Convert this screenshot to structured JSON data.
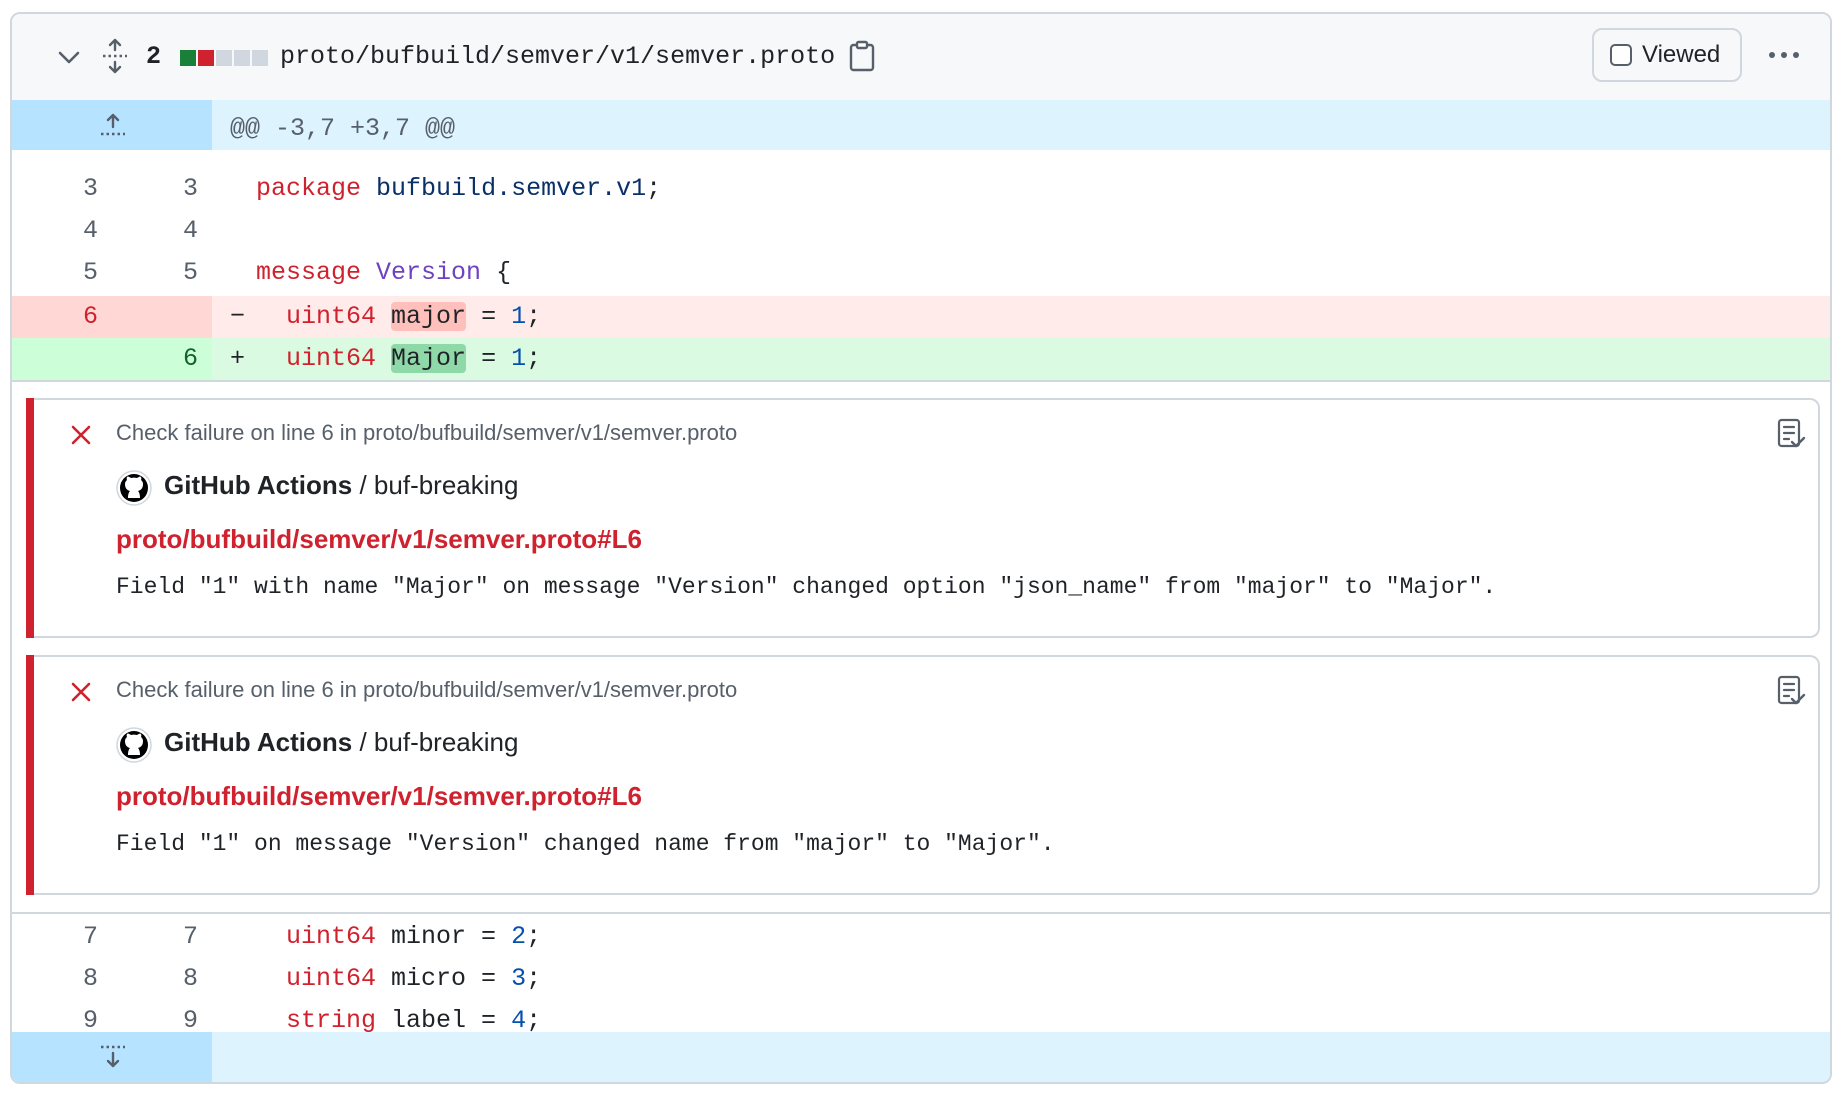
{
  "header": {
    "changes_count": "2",
    "diffstat_colors": [
      "#1a7f37",
      "#cf222e",
      "#d0d7de",
      "#d0d7de",
      "#d0d7de"
    ],
    "file_path": "proto/bufbuild/semver/v1/semver.proto",
    "viewed_label": "Viewed",
    "icons": [
      "chevron-down-icon",
      "unfold-icon",
      "copy-icon",
      "kebab-icon"
    ]
  },
  "hunk_header": "@@ -3,7 +3,7 @@",
  "lines_top": [
    {
      "old": "3",
      "new": "3",
      "tokens": [
        {
          "t": "package",
          "c": "kw"
        },
        {
          "t": " ",
          "c": ""
        },
        {
          "t": "bufbuild.semver.v1",
          "c": "pkg"
        },
        {
          "t": ";",
          "c": ""
        }
      ]
    },
    {
      "old": "4",
      "new": "4",
      "tokens": []
    },
    {
      "old": "5",
      "new": "5",
      "tokens": [
        {
          "t": "message",
          "c": "kw"
        },
        {
          "t": " ",
          "c": ""
        },
        {
          "t": "Version",
          "c": "ty"
        },
        {
          "t": " {",
          "c": ""
        }
      ]
    }
  ],
  "deleted_line": {
    "old": "6",
    "sign": "−",
    "pre": "  ",
    "type": "uint64",
    "ident": "major",
    "post": " = ",
    "num": "1",
    "end": ";"
  },
  "added_line": {
    "new": "6",
    "sign": "+",
    "pre": "  ",
    "type": "uint64",
    "ident": "Major",
    "post": " = ",
    "num": "1",
    "end": ";"
  },
  "annotations": [
    {
      "title": "Check failure on line 6 in proto/bufbuild/semver/v1/semver.proto",
      "app": "GitHub Actions",
      "job": " / buf-breaking",
      "link": "proto/bufbuild/semver/v1/semver.proto#L6",
      "message": "Field \"1\" with name \"Major\" on message \"Version\" changed option \"json_name\" from \"major\" to \"Major\"."
    },
    {
      "title": "Check failure on line 6 in proto/bufbuild/semver/v1/semver.proto",
      "app": "GitHub Actions",
      "job": " / buf-breaking",
      "link": "proto/bufbuild/semver/v1/semver.proto#L6",
      "message": "Field \"1\" on message \"Version\" changed name from \"major\" to \"Major\"."
    }
  ],
  "lines_bottom": [
    {
      "old": "7",
      "new": "7",
      "type": "uint64",
      "rest": " minor = ",
      "num": "2",
      "end": ";"
    },
    {
      "old": "8",
      "new": "8",
      "type": "uint64",
      "rest": " micro = ",
      "num": "3",
      "end": ";"
    },
    {
      "old": "9",
      "new": "9",
      "type": "string",
      "rest": " label = ",
      "num": "4",
      "end": ";"
    }
  ],
  "colors": {
    "failure": "#cf222e",
    "added_bg": "#dafbe1",
    "deleted_bg": "#ffebe9",
    "hunk_bg": "#ddf4ff"
  }
}
